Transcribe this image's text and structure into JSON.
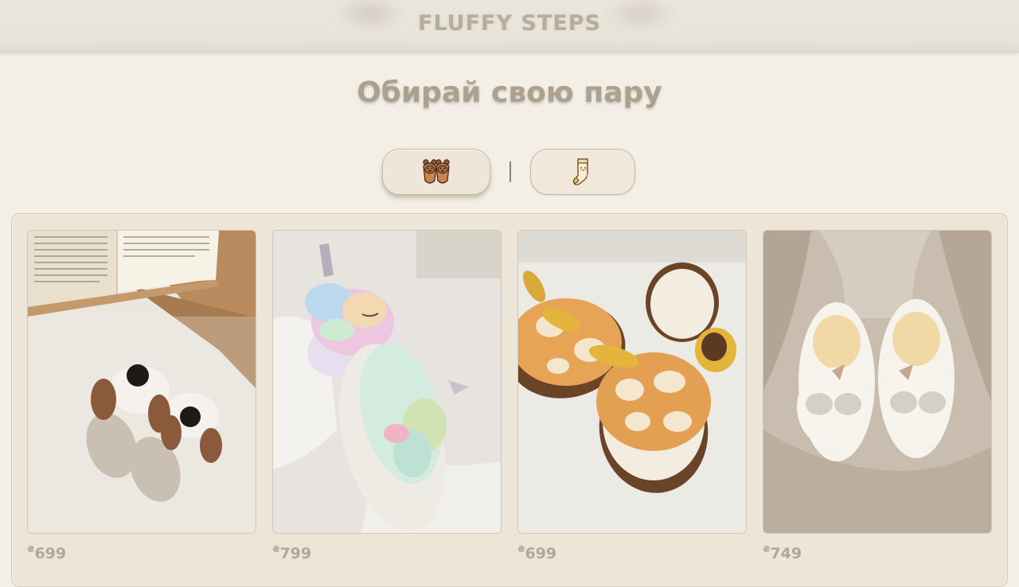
{
  "header": {
    "brand": "FLUFFY STEPS"
  },
  "hero": {
    "title": "Обирай свою пару"
  },
  "filters": [
    {
      "icon": "bear-slippers-icon",
      "active": true
    },
    {
      "icon": "sock-icon",
      "active": false
    }
  ],
  "products": [
    {
      "image": "dog-slippers-photo",
      "currency": "₴",
      "price": "699"
    },
    {
      "image": "unicorn-rainbow-slippers-photo",
      "currency": "₴",
      "price": "799"
    },
    {
      "image": "giraffe-slippers-photo",
      "currency": "₴",
      "price": "699"
    },
    {
      "image": "white-unicorn-slippers-photo",
      "currency": "₴",
      "price": "749"
    }
  ],
  "colors": {
    "background": "#f3efe6",
    "panel": "#ece5d8",
    "title_text": "#aca190",
    "price_text": "#b2a795",
    "button_bg": "#efe6d9",
    "button_border": "#c6b9a3"
  }
}
